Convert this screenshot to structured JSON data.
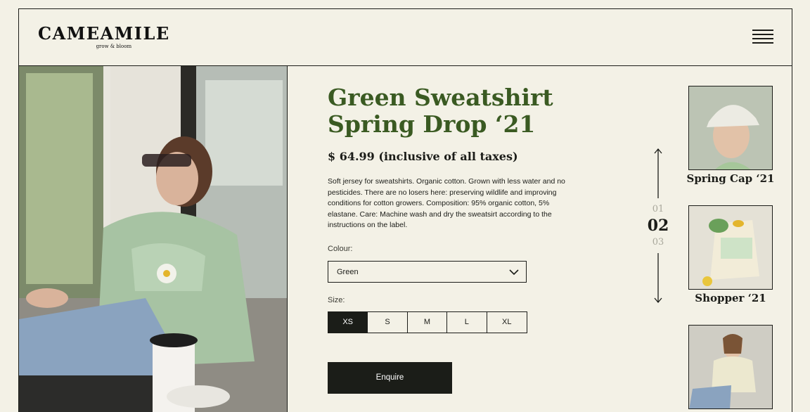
{
  "brand": {
    "name": "CAMEAMILE",
    "tagline": "grow & bloom"
  },
  "header": {
    "menu_icon": "hamburger-menu-icon"
  },
  "product": {
    "title_line1": "Green Sweatshirt",
    "title_line2": "Spring Drop ‘21",
    "price": "$ 64.99 (inclusive of all taxes)",
    "description": "Soft jersey for sweatshirts. Organic cotton. Grown with less water and no pesticides. There are no losers here: preserving wildlife and improving conditions for cotton growers. Composition: 95% organic cotton, 5% elastane. Care: Machine wash and dry the sweatsirt according to the instructions on the label."
  },
  "colour": {
    "label": "Colour:",
    "value": "Green"
  },
  "size": {
    "label": "Size:",
    "options": [
      "XS",
      "S",
      "M",
      "L",
      "XL"
    ],
    "selected": "XS"
  },
  "enquire_label": "Enquire",
  "pager": {
    "prev": "01",
    "current": "02",
    "next": "03"
  },
  "related": [
    {
      "label": "Spring Cap ‘21"
    },
    {
      "label": "Shopper ‘21"
    },
    {
      "label": ""
    }
  ],
  "colors": {
    "background": "#f3f1e6",
    "accent": "#3a5a22",
    "dark": "#1b1d18"
  }
}
